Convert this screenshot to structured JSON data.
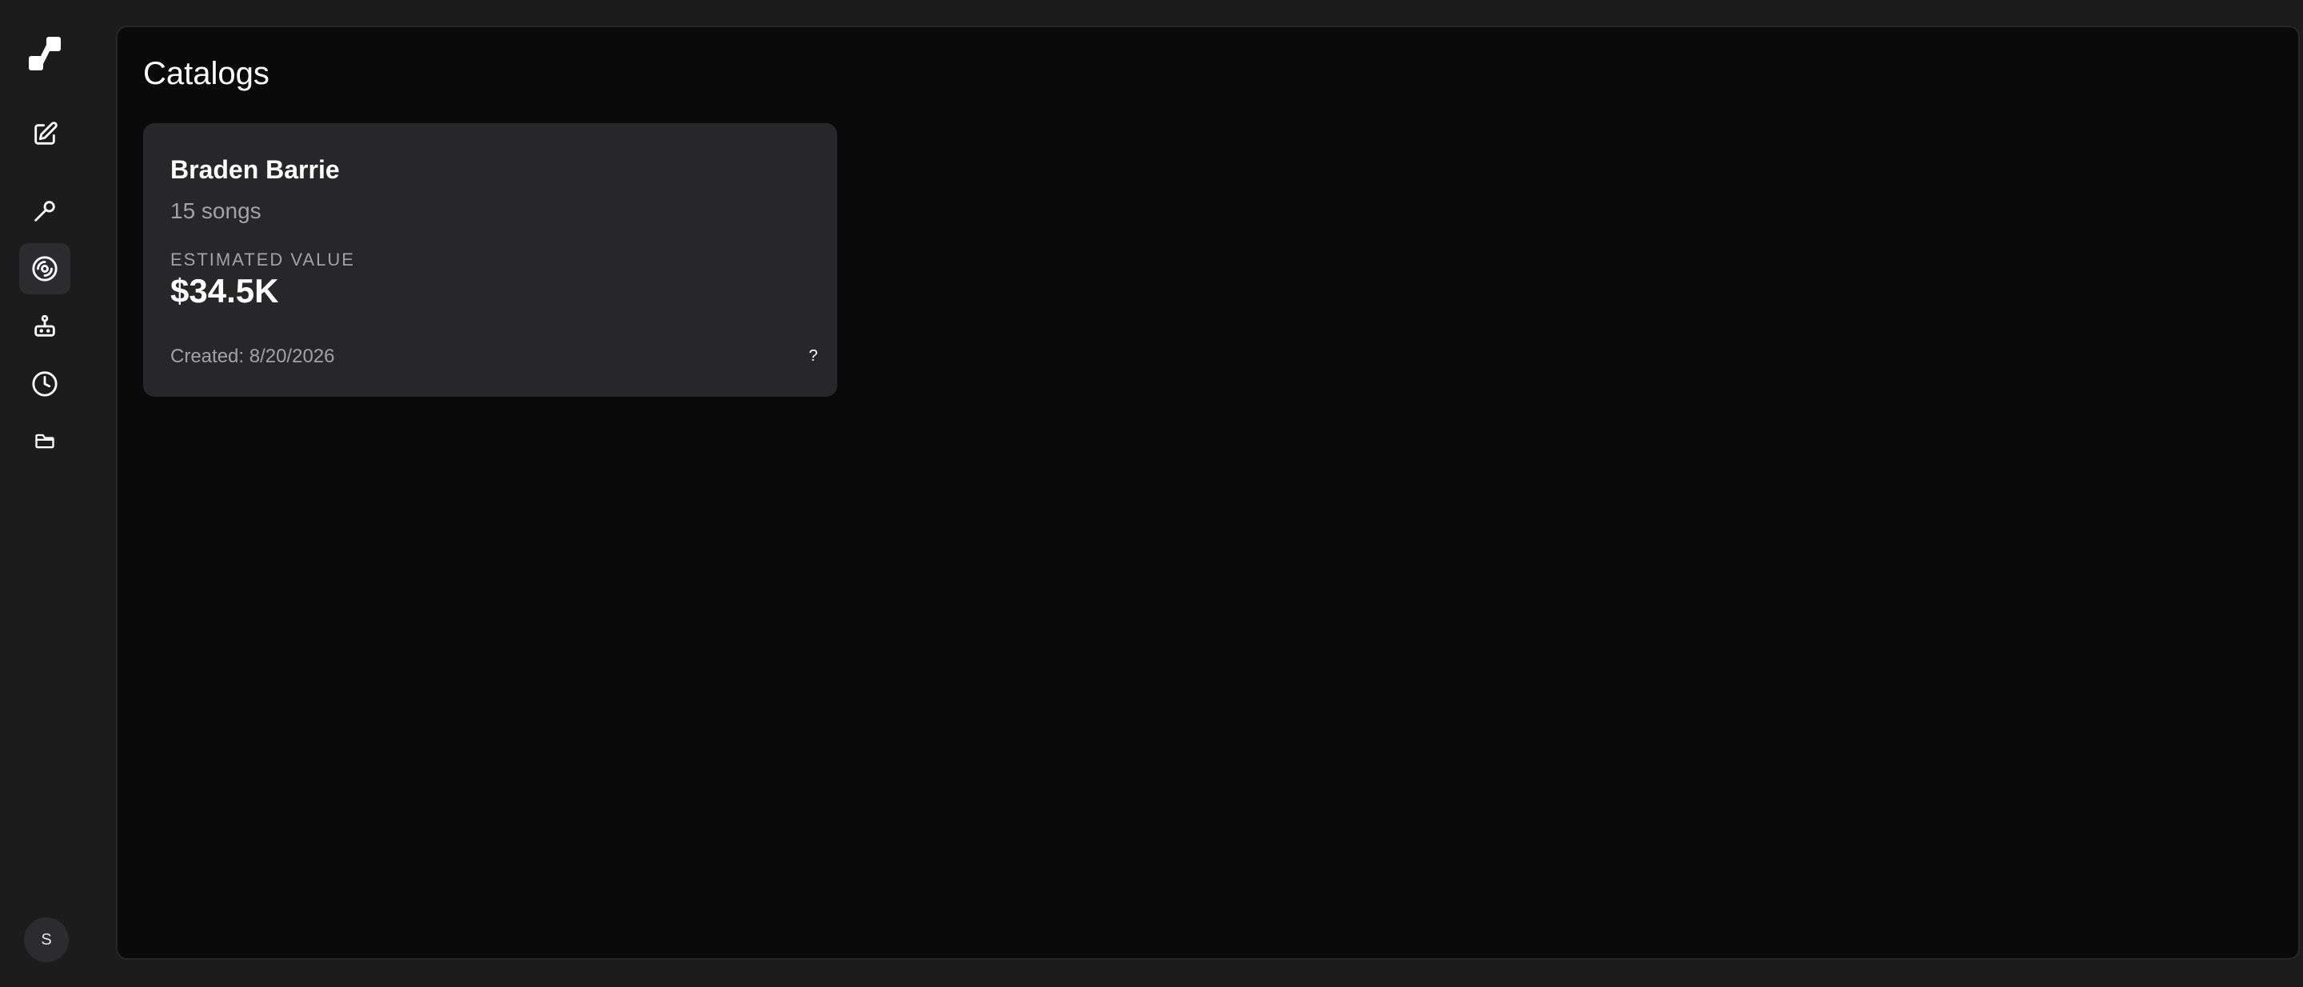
{
  "sidebar": {
    "logo_icon": "app-logo-icon",
    "items": [
      {
        "name": "compose",
        "icon": "edit-icon"
      },
      {
        "name": "tools",
        "icon": "wrench-icon"
      },
      {
        "name": "catalogs",
        "icon": "disc-icon",
        "active": true
      },
      {
        "name": "agents",
        "icon": "robot-icon"
      },
      {
        "name": "history",
        "icon": "clock-icon"
      },
      {
        "name": "files",
        "icon": "folder-icon"
      }
    ],
    "avatar_initial": "S"
  },
  "main": {
    "title": "Catalogs",
    "catalogs": [
      {
        "name": "Braden Barrie",
        "songs": "15 songs",
        "value_label": "ESTIMATED VALUE",
        "value": "$34.5K",
        "created": "Created: 8/20/2026",
        "help": "?"
      }
    ]
  },
  "colors": {
    "background": "#1c1c1c",
    "panel": "#0a0a0a",
    "card": "#27272a",
    "muted_text": "#a1a1aa",
    "active_nav": "#2c2c2e"
  }
}
